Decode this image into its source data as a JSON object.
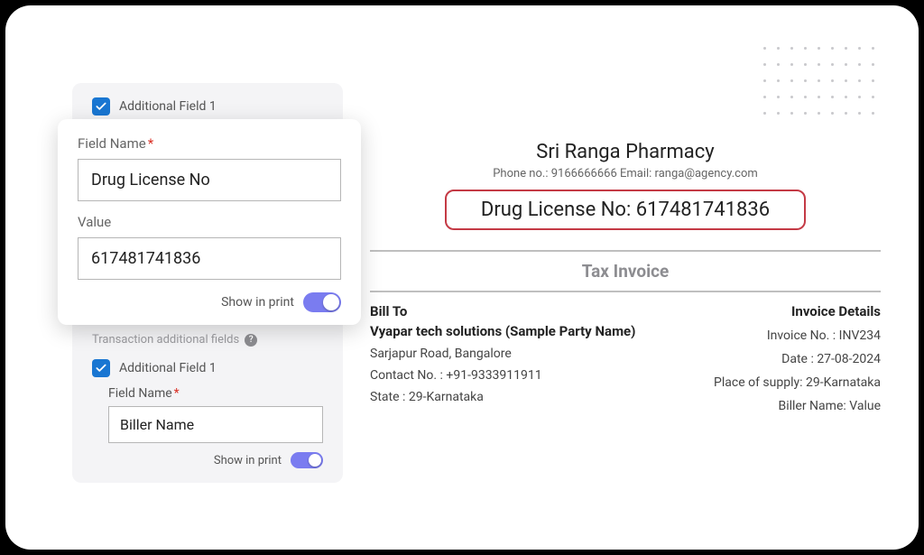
{
  "settings": {
    "field1": {
      "checkbox_label": "Additional Field 1",
      "name_label": "Field Name",
      "name_value": "Drug License No",
      "value_label": "Value",
      "value_value": "617481741836",
      "show_in_print_label": "Show in print"
    },
    "transaction_section_label": "Transaction additional fields",
    "field2": {
      "checkbox_label": "Additional Field 1",
      "name_label": "Field Name",
      "name_value": "Biller Name",
      "show_in_print_label": "Show in print"
    }
  },
  "preview": {
    "company": "Sri Ranga Pharmacy",
    "contact": "Phone no.: 9166666666 Email: ranga@agency.com",
    "license": "Drug License No: 617481741836",
    "doc_title": "Tax Invoice",
    "bill_to": {
      "head": "Bill To",
      "party": "Vyapar tech solutions (Sample Party Name)",
      "address": "Sarjapur Road, Bangalore",
      "contact": "Contact No. : +91-9333911911",
      "state": "State : 29-Karnataka"
    },
    "details": {
      "head": "Invoice Details",
      "invoice_no": "Invoice No. : INV234",
      "date": "Date : 27-08-2024",
      "place": "Place of supply: 29-Karnataka",
      "biller": "Biller Name: Value"
    }
  }
}
